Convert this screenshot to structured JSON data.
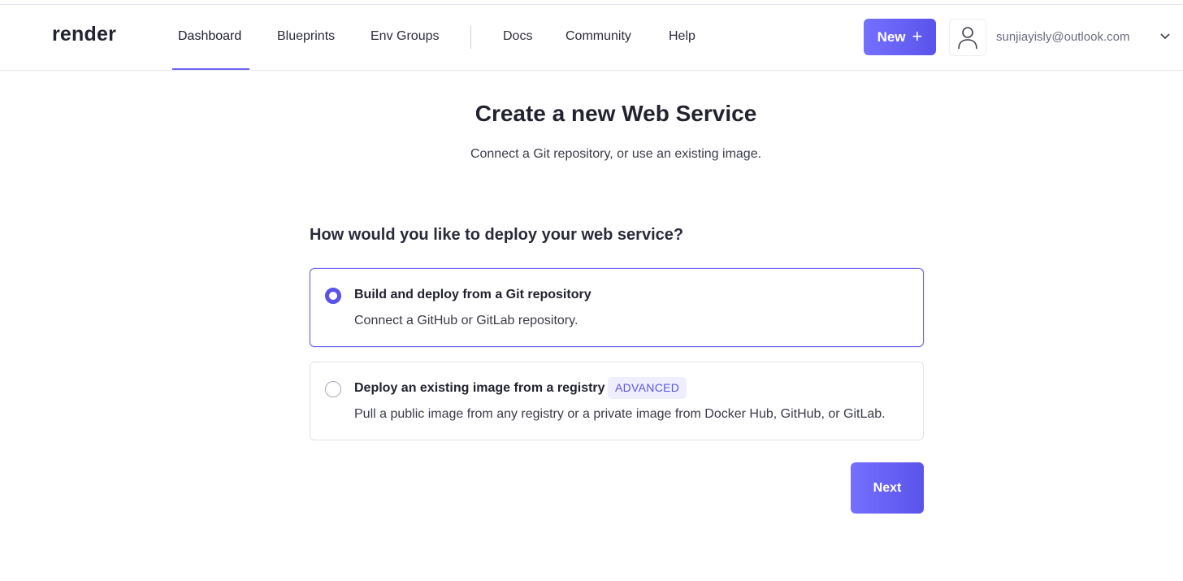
{
  "brand": {
    "logo_text": "render",
    "accent_color": "#5a53ea"
  },
  "nav": {
    "items": [
      {
        "label": "Dashboard",
        "active": true
      },
      {
        "label": "Blueprints"
      },
      {
        "label": "Env Groups"
      },
      {
        "label": "Docs"
      },
      {
        "label": "Community"
      },
      {
        "label": "Help"
      }
    ],
    "new_button": {
      "label": "New",
      "icon": "plus-icon"
    },
    "user": {
      "email": "sunjiayisly@outlook.com",
      "avatar_icon": "user-icon",
      "menu_icon": "chevron-down-icon"
    }
  },
  "page": {
    "title_prefix": "Create a new",
    "title_strong": "Web Service",
    "subtitle": "Connect a Git repository, or use an existing image.",
    "question": "How would you like to deploy your web service?",
    "options": [
      {
        "title": "Build and deploy from a Git repository",
        "description": "Connect a GitHub or GitLab repository.",
        "selected": true
      },
      {
        "title": "Deploy an existing image from a registry",
        "badge": "ADVANCED",
        "description": "Pull a public image from any registry or a private image from Docker Hub, GitHub, or GitLab.",
        "selected": false
      }
    ],
    "next_button": "Next"
  }
}
